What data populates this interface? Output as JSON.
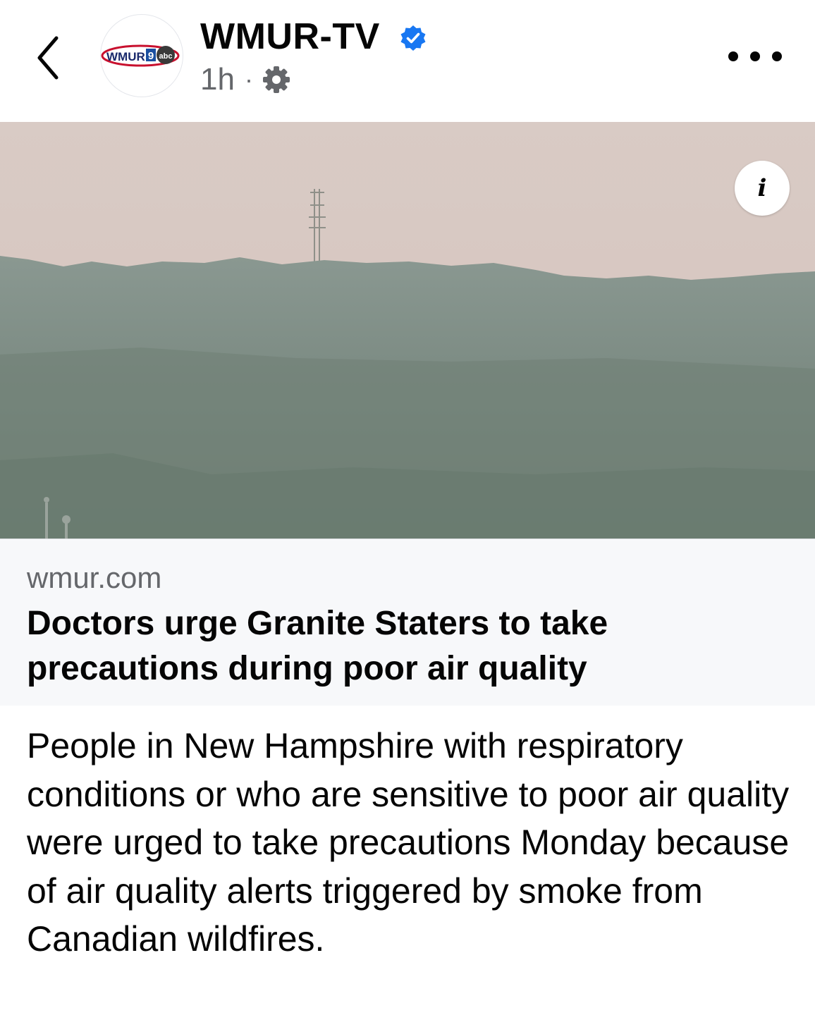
{
  "post": {
    "page_name": "WMUR-TV",
    "verified": true,
    "timestamp": "1h",
    "separator": "·",
    "privacy_icon": "gear-icon",
    "avatar_logo_text": "WMUR",
    "avatar_logo_channel": "9",
    "avatar_logo_network": "abc"
  },
  "link_card": {
    "domain": "wmur.com",
    "headline": "Doctors urge Granite Staters to take precautions during poor air quality",
    "info_label": "i"
  },
  "caption": "People in New Hampshire with respiratory conditions or who are sensitive to poor air quality were urged to take precautions Monday because of air quality alerts triggered by smoke from Canadian wildfires.",
  "colors": {
    "verified_blue": "#1877f2",
    "muted_text": "#65676b",
    "link_bg": "#f7f8fa",
    "logo_red": "#c8102e"
  }
}
